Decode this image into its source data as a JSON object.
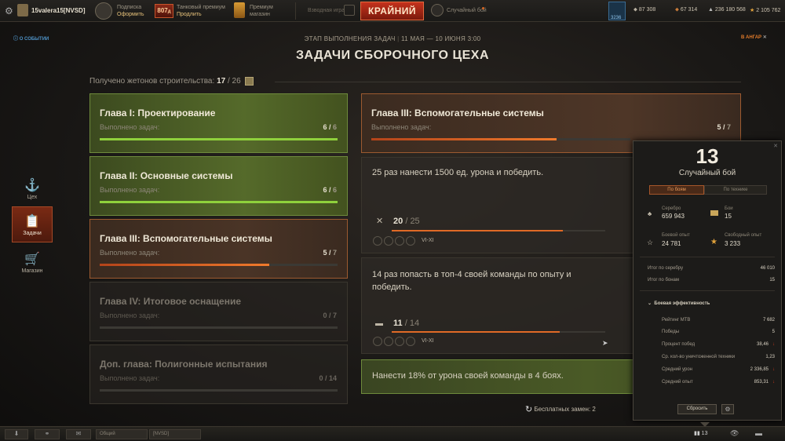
{
  "topbar": {
    "player_name": "15valera15[NVSD]",
    "subscription_line1": "Подписка",
    "subscription_line2": "Оформить",
    "premium_days": "807",
    "premium_days_unit": "д",
    "premium_line1": "Танковый премиум",
    "premium_line2": "Продлить",
    "shop_line1": "Премиум",
    "shop_line2": "магазин",
    "left_mode": "Взводная игра",
    "battle_button": "КРАЙНИЙ",
    "battle_mode": "Случайный бой",
    "currency_badge": "3236",
    "currencies": [
      "87 308",
      "67 314",
      "236 180 568",
      "2 105 762"
    ]
  },
  "header": {
    "event_link": "О СОБЫТИИ",
    "stage": "ЭТАП ВЫПОЛНЕНИЯ ЗАДАЧ",
    "dates": "11 МАЯ — 10 ИЮНЯ 3:00",
    "title": "ЗАДАЧИ СБОРОЧНОГО ЦЕХА",
    "hangar_link": "В АНГАР"
  },
  "tokens": {
    "label": "Получено жетонов строительства:",
    "current": "17",
    "separator": "/",
    "total": "26"
  },
  "sidebar": [
    {
      "label": "Цех"
    },
    {
      "label": "Задачи"
    },
    {
      "label": "Магазин"
    }
  ],
  "chapters": [
    {
      "title": "Глава I: Проектирование",
      "sub": "Выполнено задач:",
      "done": "6",
      "total": "6",
      "fraction": 1.0,
      "state": "complete"
    },
    {
      "title": "Глава II: Основные системы",
      "sub": "Выполнено задач:",
      "done": "6",
      "total": "6",
      "fraction": 1.0,
      "state": "complete"
    },
    {
      "title": "Глава III: Вспомогательные системы",
      "sub": "Выполнено задач:",
      "done": "5",
      "total": "7",
      "fraction": 0.714,
      "state": "active"
    },
    {
      "title": "Глава IV: Итоговое оснащение",
      "sub": "Выполнено задач:",
      "done": "0",
      "total": "7",
      "fraction": 0,
      "state": "locked"
    },
    {
      "title": "Доп. глава: Полигонные испытания",
      "sub": "Выполнено задач:",
      "done": "0",
      "total": "14",
      "fraction": 0,
      "state": "locked"
    }
  ],
  "detail": {
    "title": "Глава III: Вспомогательные системы",
    "sub": "Выполнено задач:",
    "done": "5",
    "total": "7",
    "fraction": 0.714
  },
  "quests": [
    {
      "text": "25 раз нанести 1500 ед. урона и победить.",
      "current": "20",
      "total": "25",
      "fraction": 0.8,
      "tier": "VI-XI"
    },
    {
      "text": "14 раз попасть в топ-4 своей команды по опыту и победить.",
      "current": "11",
      "total": "14",
      "fraction": 0.786,
      "tier": "VI-XI"
    },
    {
      "text": "Нанести 18% от урона своей команды в 4 боях."
    }
  ],
  "free_swaps": "Бесплатных замен: 2",
  "stats": {
    "count": "13",
    "mode": "Случайный бой",
    "tab_battles": "По боям",
    "tab_vehicles": "По технике",
    "silver_label": "Серебро",
    "silver": "659 943",
    "battles_label": "Бои",
    "battles": "15",
    "xp_label": "Боевой опыт",
    "xp": "24 781",
    "free_xp_label": "Свободный опыт",
    "free_xp": "3 233",
    "total_silver_label": "Итог по серебру",
    "total_silver": "46 010",
    "total_bonds_label": "Итог по бонам",
    "total_bonds": "15",
    "eff_label": "Боевая эффективность",
    "rows": [
      {
        "label": "Рейтинг МТВ",
        "value": "7 682"
      },
      {
        "label": "Победы",
        "value": "5"
      },
      {
        "label": "Процент побед",
        "value": "38,46"
      },
      {
        "label": "Ср. кол-во уничтоженной техники",
        "value": "1,23"
      },
      {
        "label": "Средний урон",
        "value": "2 336,85"
      },
      {
        "label": "Средний опыт",
        "value": "853,31"
      }
    ],
    "reset": "Сбросить"
  },
  "bottombar": {
    "chat_general": "Общий",
    "chat_clan": "[NVSD]",
    "counter": "13"
  }
}
